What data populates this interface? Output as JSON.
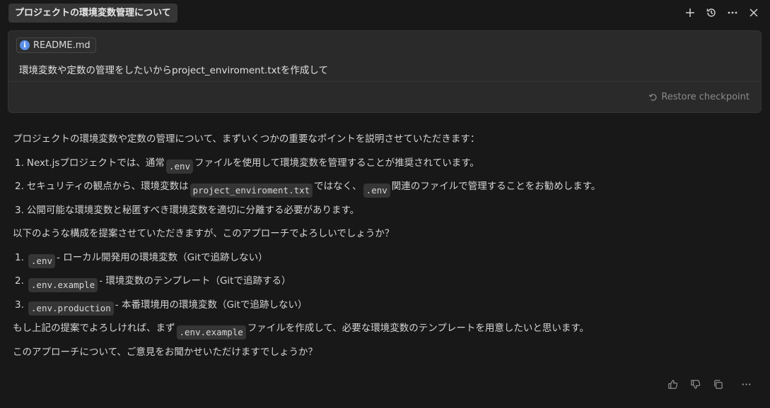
{
  "header": {
    "title": "プロジェクトの環境変数管理について",
    "icons": [
      "plus-icon",
      "history-icon",
      "more-icon",
      "close-icon"
    ]
  },
  "user_card": {
    "file_chip": "README.md",
    "message": "環境変数や定数の管理をしたいからproject_enviroment.txtを作成して",
    "restore_label": "Restore checkpoint"
  },
  "response": {
    "intro": "プロジェクトの環境変数や定数の管理について、まずいくつかの重要なポイントを説明させていただきます：",
    "points": [
      {
        "num": "1.",
        "pre": "Next.jsプロジェクトでは、通常",
        "code": ".env",
        "post": "ファイルを使用して環境変数を管理することが推奨されています。"
      },
      {
        "num": "2.",
        "pre": "セキュリティの観点から、環境変数は",
        "code": "project_enviroment.txt",
        "mid": "ではなく、",
        "code2": ".env",
        "post": "関連のファイルで管理することをお勧めします。"
      },
      {
        "num": "3.",
        "pre": "公開可能な環境変数と秘匿すべき環境変数を適切に分離する必要があります。"
      }
    ],
    "proposal": "以下のような構成を提案させていただきますが、このアプローチでよろしいでしょうか？",
    "files": [
      {
        "num": "1.",
        "code": ".env",
        "desc": " - ローカル開発用の環境変数（Gitで追跡しない）"
      },
      {
        "num": "2.",
        "code": ".env.example",
        "desc": " - 環境変数のテンプレート（Gitで追跡する）"
      },
      {
        "num": "3.",
        "code": ".env.production",
        "desc": " - 本番環境用の環境変数（Gitで追跡しない）"
      }
    ],
    "next_pre": "もし上記の提案でよろしければ、まず",
    "next_code": ".env.example",
    "next_post": "ファイルを作成して、必要な環境変数のテンプレートを用意したいと思います。",
    "closing": "このアプローチについて、ご意見をお聞かせいただけますでしょうか？"
  },
  "footer": {
    "icons": [
      "thumbs-up-icon",
      "thumbs-down-icon",
      "copy-icon",
      "more-icon"
    ]
  }
}
